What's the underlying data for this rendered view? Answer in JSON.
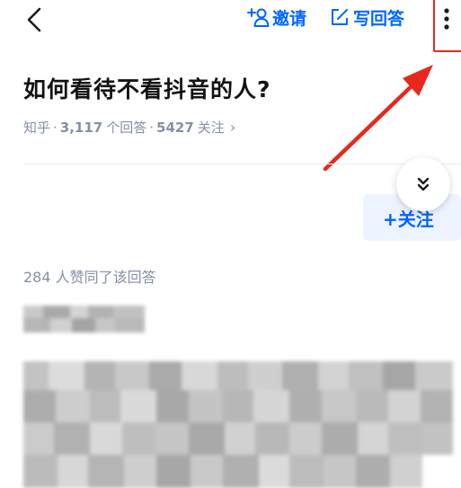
{
  "top_bar": {
    "back_icon": "chevron-left-icon",
    "invite_label": "邀请",
    "invite_icon": "add-person-icon",
    "write_answer_label": "写回答",
    "write_answer_icon": "edit-icon",
    "more_icon": "vertical-dots-icon"
  },
  "question": {
    "title": "如何看待不看抖音的人?",
    "source": "知乎",
    "answer_count": "3,117",
    "answer_label": "个回答",
    "follow_count": "5427",
    "follow_label": "关注",
    "sep": "·",
    "chevron": "›"
  },
  "answer": {
    "follow_author_label": "+关注",
    "upvote_summary": "284 人赞同了该回答",
    "collapse_icon": "double-chevron-down-icon"
  },
  "annotation": {
    "color": "#e8281e"
  },
  "colors": {
    "brand": "#0066ff",
    "meta_text": "#8590a6"
  }
}
